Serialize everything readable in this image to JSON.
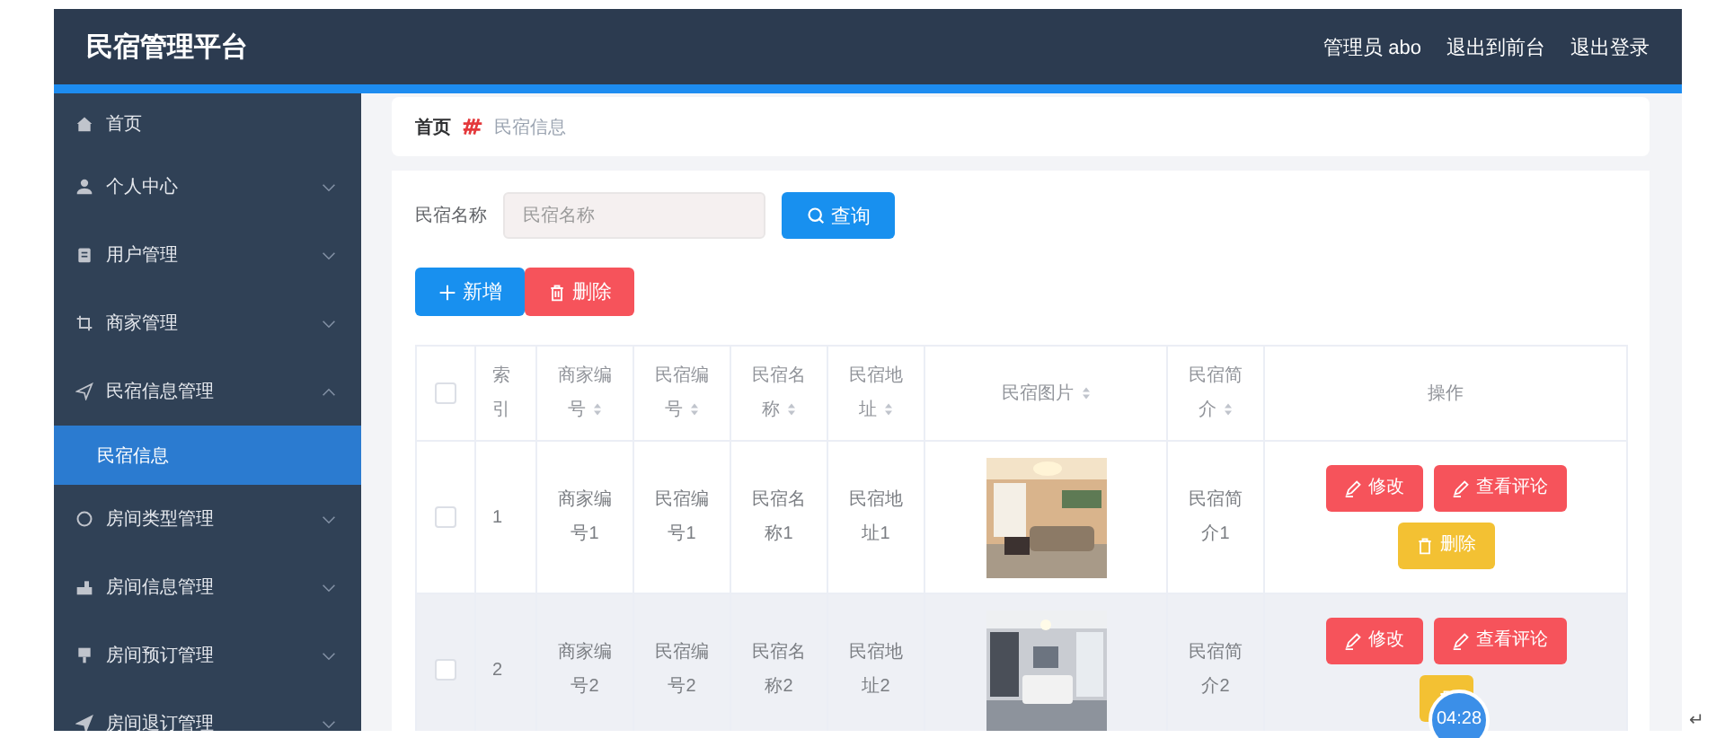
{
  "header": {
    "title": "民宿管理平台",
    "links": [
      "管理员 abo",
      "退出到前台",
      "退出登录"
    ]
  },
  "sidebar": {
    "items": [
      {
        "label": "首页",
        "kind": "link"
      },
      {
        "label": "个人中心",
        "kind": "submenu",
        "expanded": false
      },
      {
        "label": "用户管理",
        "kind": "submenu",
        "expanded": false
      },
      {
        "label": "商家管理",
        "kind": "submenu",
        "expanded": false
      },
      {
        "label": "民宿信息管理",
        "kind": "submenu",
        "expanded": true,
        "children": [
          {
            "label": "民宿信息",
            "selected": true
          }
        ]
      },
      {
        "label": "房间类型管理",
        "kind": "submenu",
        "expanded": false
      },
      {
        "label": "房间信息管理",
        "kind": "submenu",
        "expanded": false
      },
      {
        "label": "房间预订管理",
        "kind": "submenu",
        "expanded": false
      },
      {
        "label": "房间退订管理",
        "kind": "submenu",
        "expanded": false
      }
    ]
  },
  "breadcrumb": [
    "首页",
    "民宿信息"
  ],
  "search": {
    "label": "民宿名称",
    "placeholder": "民宿名称",
    "button": "查询"
  },
  "toolbar": [
    "新增",
    "删除"
  ],
  "table": {
    "select_all": {
      "checked": false
    },
    "columns": [
      {
        "label": "索引",
        "sortable": false
      },
      {
        "label": "商家编号",
        "sortable": true
      },
      {
        "label": "民宿编号",
        "sortable": true
      },
      {
        "label": "民宿名称",
        "sortable": true
      },
      {
        "label": "民宿地址",
        "sortable": true
      },
      {
        "label": "民宿图片",
        "sortable": true
      },
      {
        "label": "民宿简介",
        "sortable": true
      },
      {
        "label": "操作",
        "sortable": false
      }
    ],
    "rows": [
      {
        "checked": false,
        "highlighted": false,
        "cells": [
          "1",
          "商家编号1",
          "民宿编号1",
          "民宿名称1",
          "民宿地址1"
        ],
        "intro": "民宿简介1",
        "actions": [
          {
            "kind": "edit",
            "label": "修改"
          },
          {
            "kind": "comment",
            "label": "查看评论"
          },
          {
            "kind": "delete",
            "label": "删除"
          }
        ]
      },
      {
        "checked": false,
        "highlighted": true,
        "cells": [
          "2",
          "商家编号2",
          "民宿编号2",
          "民宿名称2",
          "民宿地址2"
        ],
        "intro": "民宿简介2",
        "actions": [
          {
            "kind": "edit",
            "label": "修改"
          },
          {
            "kind": "comment",
            "label": "查看评论"
          },
          {
            "kind": "delete"
          }
        ]
      }
    ]
  },
  "timer_badge": "04:28",
  "return_mark": "↵"
}
